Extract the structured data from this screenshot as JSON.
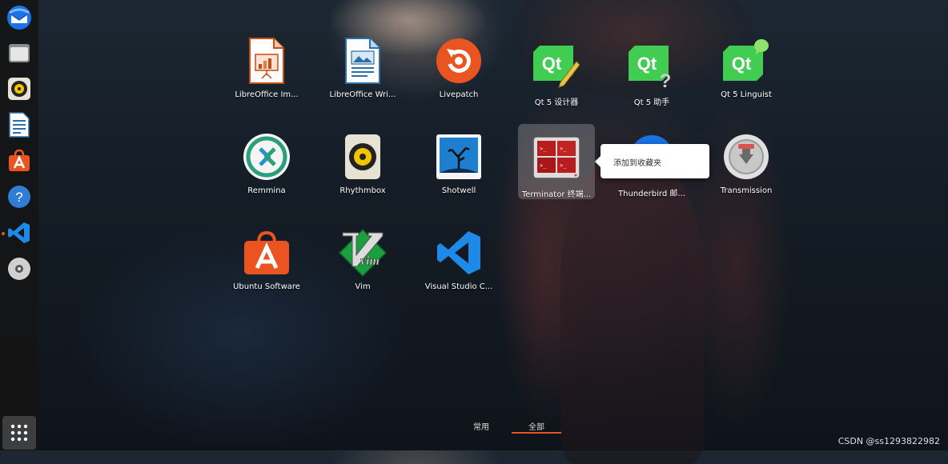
{
  "dock": {
    "items": [
      {
        "name": "thunderbird"
      },
      {
        "name": "files"
      },
      {
        "name": "rhythmbox"
      },
      {
        "name": "libreoffice-writer"
      },
      {
        "name": "ubuntu-software"
      },
      {
        "name": "help"
      },
      {
        "name": "vscode",
        "active": true
      },
      {
        "name": "dvd"
      }
    ],
    "show_apps_icon": "grid-icon"
  },
  "apps": [
    {
      "label": "LibreOffice Im...",
      "icon": "libreoffice-impress-icon"
    },
    {
      "label": "LibreOffice Wri...",
      "icon": "libreoffice-writer-icon"
    },
    {
      "label": "Livepatch",
      "icon": "livepatch-icon"
    },
    {
      "label": "Qt 5 设计器",
      "icon": "qt-designer-icon"
    },
    {
      "label": "Qt 5 助手",
      "icon": "qt-assistant-icon"
    },
    {
      "label": "Qt 5 Linguist",
      "icon": "qt-linguist-icon"
    },
    {
      "label": "Remmina",
      "icon": "remmina-icon"
    },
    {
      "label": "Rhythmbox",
      "icon": "rhythmbox-icon"
    },
    {
      "label": "Shotwell",
      "icon": "shotwell-icon"
    },
    {
      "label": "Terminator 终端...",
      "icon": "terminator-icon",
      "selected": true
    },
    {
      "label": "Thunderbird 邮...",
      "icon": "thunderbird-icon"
    },
    {
      "label": "Transmission",
      "icon": "transmission-icon"
    },
    {
      "label": "Ubuntu Software",
      "icon": "ubuntu-software-icon"
    },
    {
      "label": "Vim",
      "icon": "vim-icon"
    },
    {
      "label": "Visual Studio C...",
      "icon": "vscode-icon"
    }
  ],
  "context_menu": {
    "item": "添加到收藏夹"
  },
  "tabs": {
    "frequent": "常用",
    "all": "全部",
    "active": "all"
  },
  "watermark": "CSDN @ss1293822982",
  "colors": {
    "accent": "#e95420",
    "qt_green": "#41cd52",
    "vscode_blue": "#0078d4"
  }
}
